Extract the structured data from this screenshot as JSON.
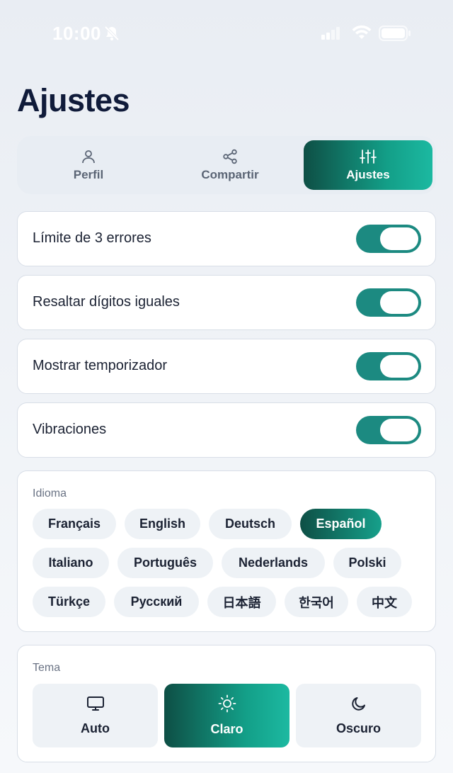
{
  "status_bar": {
    "time": "10:00",
    "icons": [
      "bell-slash-icon",
      "signal-icon",
      "wifi-icon",
      "battery-icon"
    ]
  },
  "page": {
    "title": "Ajustes"
  },
  "tabs": [
    {
      "label": "Perfil",
      "icon": "person-icon",
      "active": false
    },
    {
      "label": "Compartir",
      "icon": "share-icon",
      "active": false
    },
    {
      "label": "Ajustes",
      "icon": "sliders-icon",
      "active": true
    }
  ],
  "toggles": [
    {
      "label": "Límite de 3 errores",
      "on": true
    },
    {
      "label": "Resaltar dígitos iguales",
      "on": true
    },
    {
      "label": "Mostrar temporizador",
      "on": true
    },
    {
      "label": "Vibraciones",
      "on": true
    }
  ],
  "language": {
    "label": "Idioma",
    "selected": "Español",
    "options": [
      "Français",
      "English",
      "Deutsch",
      "Español",
      "Italiano",
      "Português",
      "Nederlands",
      "Polski",
      "Türkçe",
      "Русский",
      "日本語",
      "한국어",
      "中文"
    ]
  },
  "theme": {
    "label": "Tema",
    "selected": "Claro",
    "options": [
      {
        "label": "Auto",
        "icon": "monitor-icon"
      },
      {
        "label": "Claro",
        "icon": "sun-icon"
      },
      {
        "label": "Oscuro",
        "icon": "moon-icon"
      }
    ]
  },
  "colors": {
    "accent_dark": "#0e4f45",
    "accent_light": "#1cb9a1",
    "toggle_on": "#1c8a81",
    "title": "#101b3a"
  }
}
